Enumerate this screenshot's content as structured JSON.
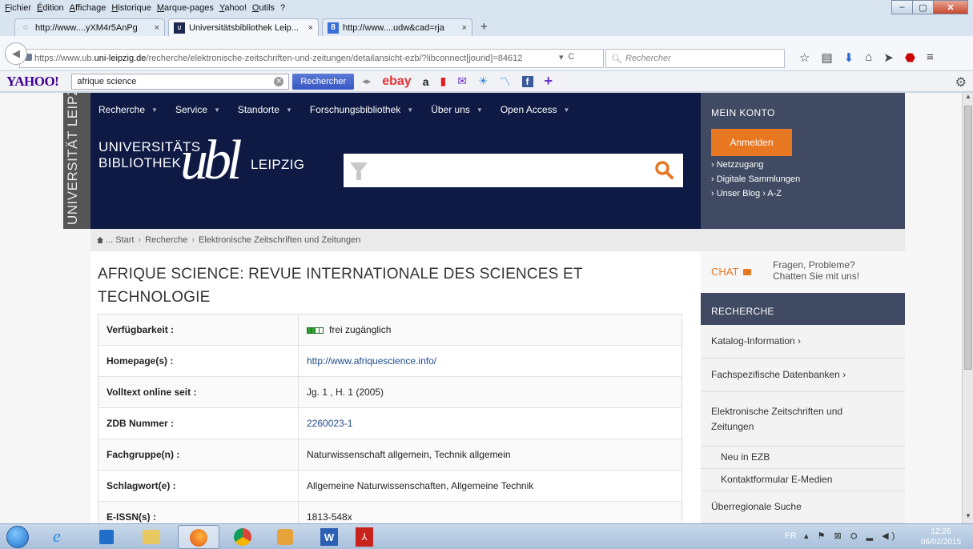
{
  "menubar": [
    "Fichier",
    "Édition",
    "Affichage",
    "Historique",
    "Marque-pages",
    "Yahoo!",
    "Outils",
    "?"
  ],
  "tabs": [
    {
      "label": "http://www....yXM4r5AnPg",
      "close": "×"
    },
    {
      "label": "Universitätsbibliothek Leip...",
      "close": "×"
    },
    {
      "label": "http://www....udw&cad=rja",
      "close": "×"
    }
  ],
  "newtab": "+",
  "url": {
    "prefix": "https://www.ub.",
    "domain": "uni-leipzig.de",
    "path": "/recherche/elektronische-zeitschriften-und-zeitungen/detailansicht-ezb/?libconnect[jourid]=84612"
  },
  "browser_search_placeholder": "Rechercher",
  "yahoo": {
    "logo": "YAHOO!",
    "query": "afrique science",
    "button": "Rechercher",
    "ebay": "ebay",
    "amazon": "a"
  },
  "side_label": "UNIVERSITÄT LEIPZIG",
  "nav": [
    "Recherche",
    "Service",
    "Standorte",
    "Forschungsbibliothek",
    "Über uns",
    "Open Access"
  ],
  "logo": {
    "line1": "UNIVERSITÄTS",
    "line2": "BIBLIOTHEK",
    "ub": "ubl",
    "city": "LEIPZIG"
  },
  "konto": {
    "title": "MEIN KONTO",
    "login": "Anmelden",
    "links": [
      "› Netzzugang",
      "› Digitale Sammlungen",
      "› Unser Blog  › A-Z"
    ]
  },
  "breadcrumb": [
    "... Start",
    "Recherche",
    "Elektronische Zeitschriften und Zeitungen"
  ],
  "title": "AFRIQUE SCIENCE: REVUE INTERNATIONALE DES SCIENCES ET TECHNOLOGIE",
  "details": [
    {
      "key": "Verfügbarkeit :",
      "value": "frei zugänglich"
    },
    {
      "key": "Homepage(s) :",
      "value": "http://www.afriquescience.info/"
    },
    {
      "key": "Volltext online seit :",
      "value": "Jg. 1 , H. 1 (2005)"
    },
    {
      "key": "ZDB Nummer :",
      "value": "2260023-1"
    },
    {
      "key": "Fachgruppe(n) :",
      "value": "Naturwissenschaft allgemein, Technik allgemein"
    },
    {
      "key": "Schlagwort(e) :",
      "value": "Allgemeine Naturwissenschaften, Allgemeine Technik"
    },
    {
      "key": "E-ISSN(s) :",
      "value": "1813-548x"
    }
  ],
  "chat": {
    "label": "CHAT",
    "text1": "Fragen, Probleme?",
    "text2": "Chatten Sie mit uns!"
  },
  "recherche": {
    "title": "RECHERCHE",
    "items": [
      "Katalog-Information ›",
      "Fachspezifische Datenbanken ›",
      "Elektronische Zeitschriften und Zeitungen",
      "Neu in EZB",
      "Kontaktformular E-Medien",
      "Überregionale Suche"
    ]
  },
  "taskbar": {
    "lang": "FR",
    "time": "12:26",
    "date": "06/02/2015"
  }
}
